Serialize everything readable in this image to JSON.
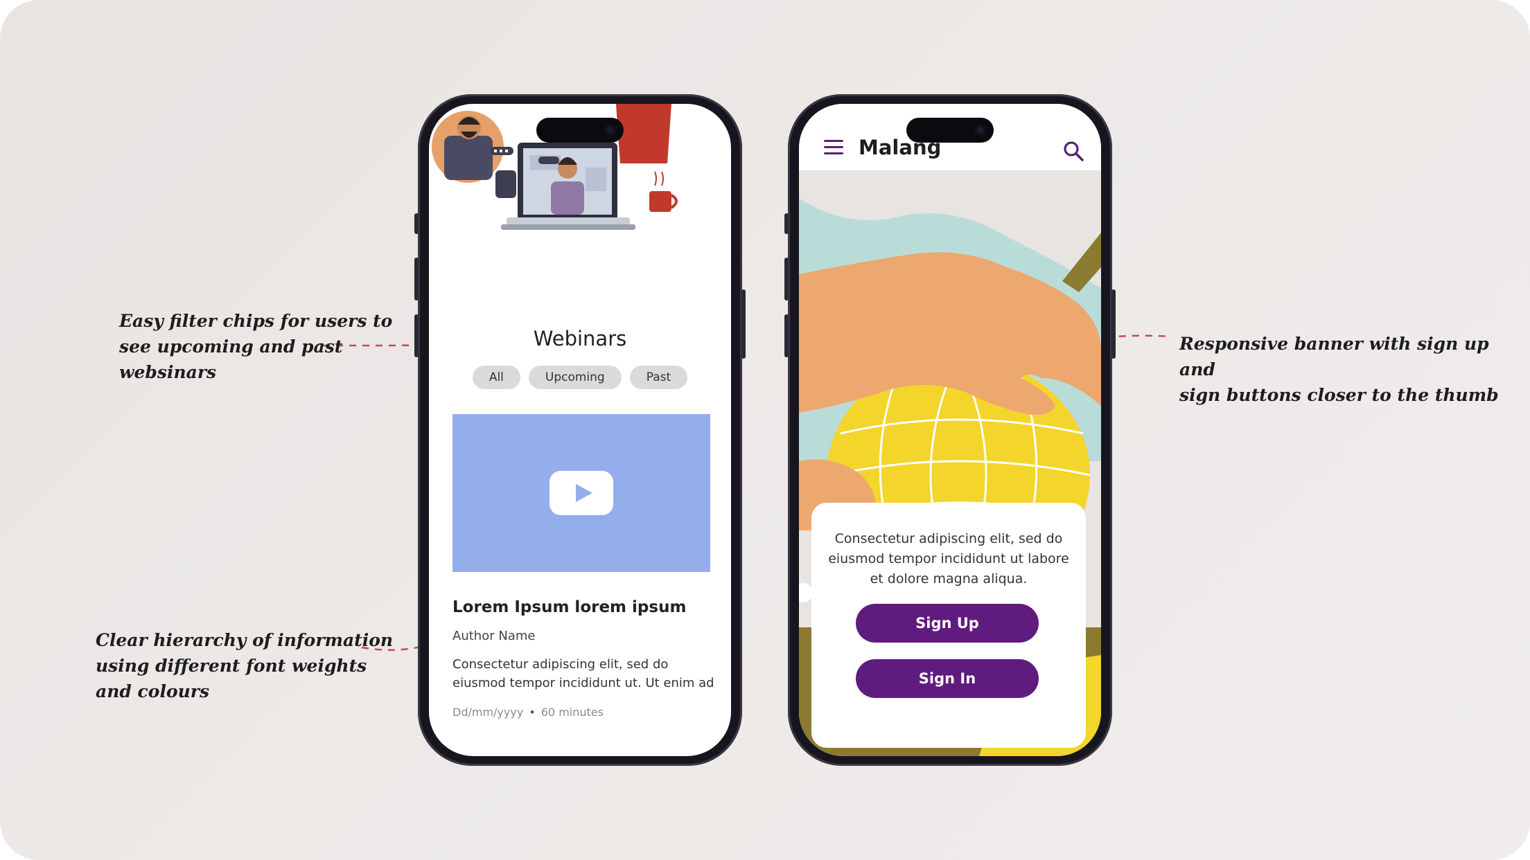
{
  "annotations": {
    "filter_chips": "Easy filter chips for users to\nsee upcoming and past\nwebsinars",
    "hierarchy": "Clear hierarchy of information\nusing different font weights\nand colours",
    "banner": "Responsive banner with sign up and\nsign buttons closer to the thumb"
  },
  "webinars_screen": {
    "title": "Webinars",
    "chips": [
      "All",
      "Upcoming",
      "Past"
    ],
    "card": {
      "title": "Lorem Ipsum lorem ipsum",
      "author": "Author Name",
      "excerpt_line1": "Consectetur adipiscing elit, sed do",
      "excerpt_line2": "eiusmod tempor incididunt ut. Ut enim ad",
      "date": "Dd/mm/yyyy",
      "separator": "•",
      "duration": "60 minutes"
    }
  },
  "signin_screen": {
    "app_name": "Malang",
    "sheet_text": "Consectetur adipiscing elit, sed do eiusmod tempor incididunt ut labore et dolore magna aliqua.",
    "sign_up_label": "Sign Up",
    "sign_in_label": "Sign In"
  },
  "icons": {
    "menu": "menu-icon",
    "search": "search-icon",
    "play": "play-icon"
  },
  "colors": {
    "brand_purple": "#601b7e",
    "accent_dash": "#c3485b",
    "chip_bg": "#dcd9dc",
    "video_bg": "#94aeec"
  }
}
